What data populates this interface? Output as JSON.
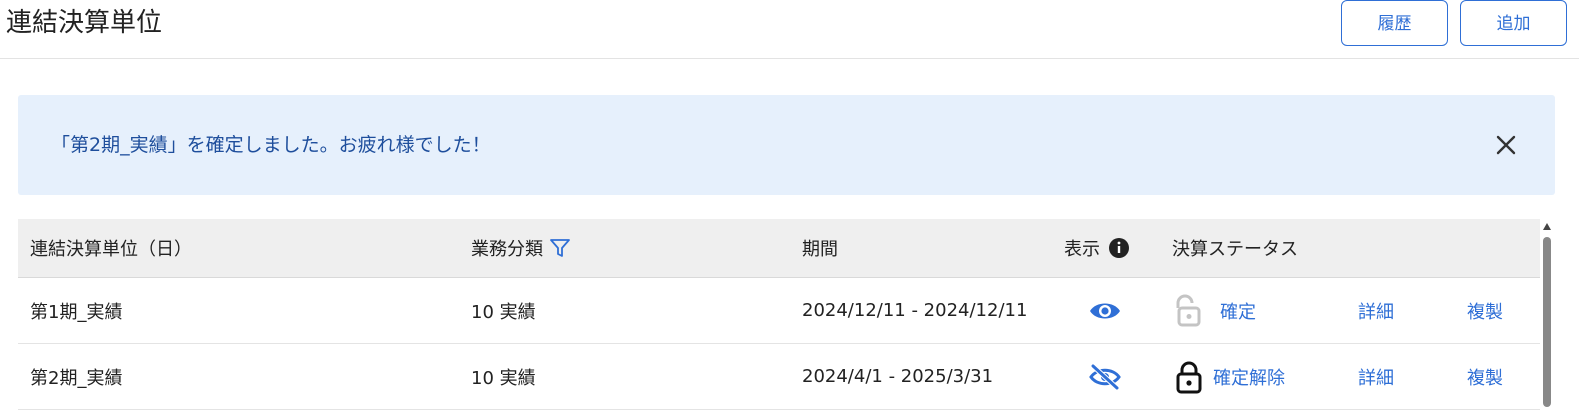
{
  "header": {
    "title": "連結決算単位",
    "history_label": "履歴",
    "add_label": "追加"
  },
  "alert": {
    "message": "「第2期_実績」を確定しました。お疲れ様でした！"
  },
  "table": {
    "columns": {
      "unit": "連結決算単位（日）",
      "category": "業務分類",
      "period": "期間",
      "display": "表示",
      "status": "決算ステータス"
    },
    "rows": [
      {
        "unit": "第1期_実績",
        "category": "10 実績",
        "period": "2024/12/11 - 2024/12/11",
        "display_icon": "eye-icon",
        "lock_icon": "unlock-icon",
        "status_action": "確定",
        "detail": "詳細",
        "copy": "複製"
      },
      {
        "unit": "第2期_実績",
        "category": "10 実績",
        "period": "2024/4/1 - 2025/3/31",
        "display_icon": "eye-off-icon",
        "lock_icon": "lock-icon",
        "status_action": "確定解除",
        "detail": "詳細",
        "copy": "複製"
      }
    ]
  },
  "colors": {
    "accent": "#2f6fd6",
    "alert_bg": "#e6f0fc",
    "alert_text": "#1e4e9c",
    "header_bg": "#efefef"
  }
}
